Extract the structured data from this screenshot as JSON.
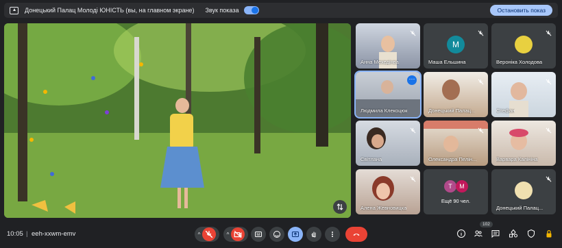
{
  "banner": {
    "title": "Донецький Палац Молоді ЮНІСТЬ (вы, на главном экране)",
    "sound_label": "Звук показа",
    "stop_label": "Остановить показ"
  },
  "tiles": [
    {
      "name": "Анна Мехедінва",
      "muted": true
    },
    {
      "name": "Маша Ельшина",
      "muted": true,
      "initial": "M",
      "avatar_color": "#128a9b"
    },
    {
      "name": "Вероніка Холодова",
      "muted": true
    },
    {
      "name": "Людмила Клекоцюк",
      "muted": false,
      "active": true
    },
    {
      "name": "Донецький Палац...",
      "muted": true
    },
    {
      "name": "Стефан",
      "muted": true
    },
    {
      "name": "Світлана",
      "muted": true
    },
    {
      "name": "Олександра Пелін...",
      "muted": true
    },
    {
      "name": "Варвара Калініна",
      "muted": true
    },
    {
      "name": "Алена Жевновицка",
      "muted": true
    },
    {
      "name": "Ещё 90 чел.",
      "muted": false,
      "avatars": [
        "T",
        "M"
      ]
    },
    {
      "name": "Донецький Палац...",
      "muted": true
    }
  ],
  "bottom": {
    "time": "10:05",
    "separator": "|",
    "meeting_code": "eeh-xxwm-emv",
    "people_count": "102"
  },
  "colors": {
    "accent": "#8ab4f8",
    "danger": "#ea4335",
    "bg": "#202124"
  }
}
